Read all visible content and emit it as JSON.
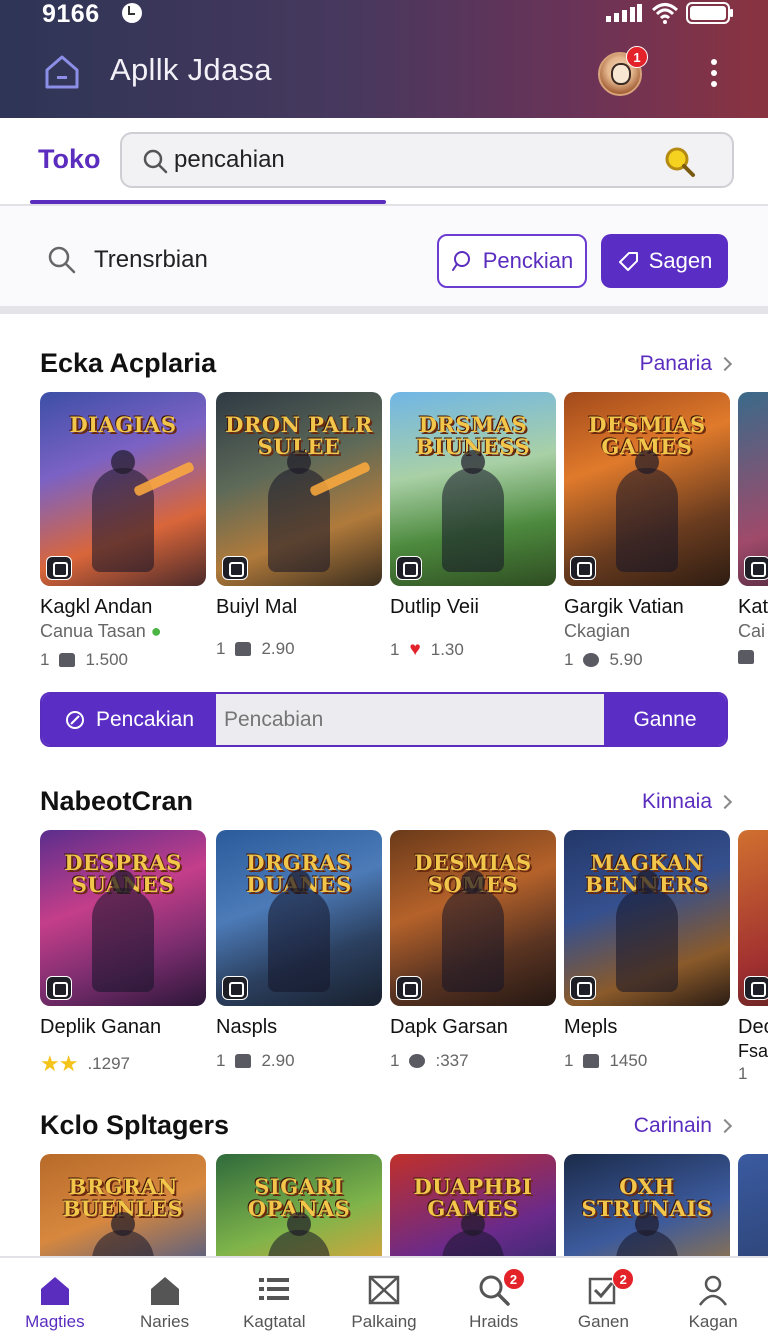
{
  "status_bar": {
    "time": "9166"
  },
  "header": {
    "title": "Apllk Jdasa",
    "notification_count": "1"
  },
  "topbar": {
    "tab": "Toko",
    "search_value": "pencahian"
  },
  "filter_row": {
    "label": "Trensrbian",
    "outline_button": "Penckian",
    "filled_button": "Sagen"
  },
  "sections": [
    {
      "title": "Ecka Acplaria",
      "link": "Panaria",
      "cards": [
        {
          "art_title": "DIAGIAS",
          "title": "Kagkl Andan",
          "sub": "Canua Tasan",
          "count": "1",
          "value": "1.500"
        },
        {
          "art_title": "DRON PALR SULEE",
          "title": "Buiyl Mal",
          "sub": "",
          "count": "1",
          "value": "2.90"
        },
        {
          "art_title": "DRSMAS BIUNESS",
          "title": "Dutlip Veii",
          "sub": "",
          "count": "1",
          "value": "1.30"
        },
        {
          "art_title": "DESMIAS GAMES",
          "title": "Gargik Vatian",
          "sub": "Ckagian",
          "count": "1",
          "value": "5.90"
        },
        {
          "art_title": "",
          "title": "Kat",
          "sub": "Cai",
          "count": "",
          "value": ""
        }
      ]
    },
    {
      "title": "NabeotCran",
      "link": "Kinnaia",
      "cards": [
        {
          "art_title": "DESPRAS SUANES",
          "title": "Deplik Ganan",
          "rating": 2,
          "value": ".1297"
        },
        {
          "art_title": "DRGRAS DUANES",
          "title": "Naspls",
          "count": "1",
          "value": "2.90"
        },
        {
          "art_title": "DESMIAS SOMES",
          "title": "Dapk Garsan",
          "count": "1",
          "value": ":337"
        },
        {
          "art_title": "MAGKAN BENNERS",
          "title": "Mepls",
          "count": "1",
          "value": "1450"
        },
        {
          "art_title": "",
          "title": "Dec",
          "sub": "Fsa",
          "count": "1",
          "value": ""
        }
      ]
    },
    {
      "title": "Kclo Spltagers",
      "link": "Carinain",
      "cards": [
        {
          "art_title": "BRGRAN BUENLES"
        },
        {
          "art_title": "SIGARI OPANAS"
        },
        {
          "art_title": "DUAPHBI GAMES"
        },
        {
          "art_title": "OXH STRUNAIS"
        },
        {
          "art_title": ""
        }
      ]
    }
  ],
  "search_strip": {
    "left_button": "Pencakian",
    "placeholder": "Pencabian",
    "right_button": "Ganne"
  },
  "bottom_nav": [
    {
      "label": "Magties",
      "icon": "home-icon",
      "active": true
    },
    {
      "label": "Naries",
      "icon": "house-icon"
    },
    {
      "label": "Kagtatal",
      "icon": "list-icon"
    },
    {
      "label": "Palkaing",
      "icon": "box-icon"
    },
    {
      "label": "Hraids",
      "icon": "search-icon",
      "badge": "2"
    },
    {
      "label": "Ganen",
      "icon": "check-icon",
      "badge": "2"
    },
    {
      "label": "Kagan",
      "icon": "profile-icon"
    }
  ],
  "colors": {
    "accent": "#5b2dbf",
    "badge": "#e32229",
    "star": "#f4c41c"
  }
}
